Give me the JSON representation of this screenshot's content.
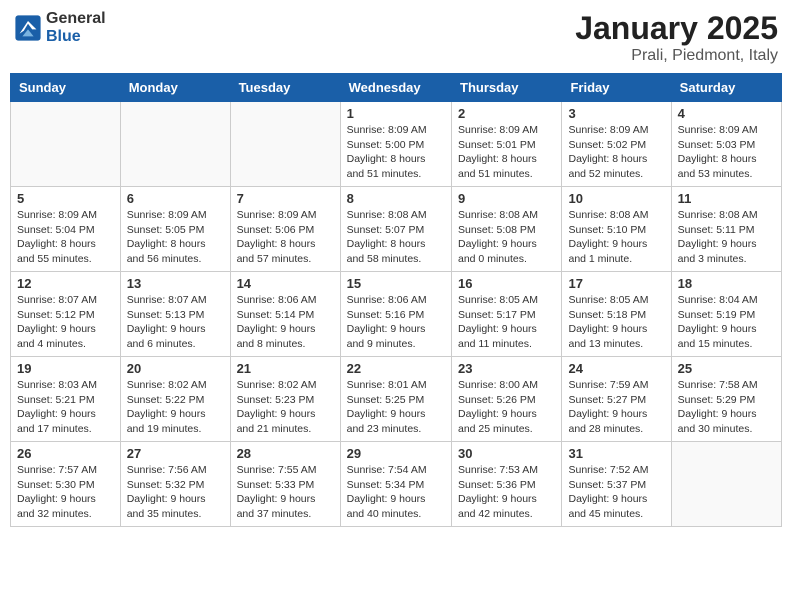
{
  "logo": {
    "general": "General",
    "blue": "Blue"
  },
  "header": {
    "month": "January 2025",
    "location": "Prali, Piedmont, Italy"
  },
  "weekdays": [
    "Sunday",
    "Monday",
    "Tuesday",
    "Wednesday",
    "Thursday",
    "Friday",
    "Saturday"
  ],
  "weeks": [
    [
      {
        "day": "",
        "info": ""
      },
      {
        "day": "",
        "info": ""
      },
      {
        "day": "",
        "info": ""
      },
      {
        "day": "1",
        "info": "Sunrise: 8:09 AM\nSunset: 5:00 PM\nDaylight: 8 hours\nand 51 minutes."
      },
      {
        "day": "2",
        "info": "Sunrise: 8:09 AM\nSunset: 5:01 PM\nDaylight: 8 hours\nand 51 minutes."
      },
      {
        "day": "3",
        "info": "Sunrise: 8:09 AM\nSunset: 5:02 PM\nDaylight: 8 hours\nand 52 minutes."
      },
      {
        "day": "4",
        "info": "Sunrise: 8:09 AM\nSunset: 5:03 PM\nDaylight: 8 hours\nand 53 minutes."
      }
    ],
    [
      {
        "day": "5",
        "info": "Sunrise: 8:09 AM\nSunset: 5:04 PM\nDaylight: 8 hours\nand 55 minutes."
      },
      {
        "day": "6",
        "info": "Sunrise: 8:09 AM\nSunset: 5:05 PM\nDaylight: 8 hours\nand 56 minutes."
      },
      {
        "day": "7",
        "info": "Sunrise: 8:09 AM\nSunset: 5:06 PM\nDaylight: 8 hours\nand 57 minutes."
      },
      {
        "day": "8",
        "info": "Sunrise: 8:08 AM\nSunset: 5:07 PM\nDaylight: 8 hours\nand 58 minutes."
      },
      {
        "day": "9",
        "info": "Sunrise: 8:08 AM\nSunset: 5:08 PM\nDaylight: 9 hours\nand 0 minutes."
      },
      {
        "day": "10",
        "info": "Sunrise: 8:08 AM\nSunset: 5:10 PM\nDaylight: 9 hours\nand 1 minute."
      },
      {
        "day": "11",
        "info": "Sunrise: 8:08 AM\nSunset: 5:11 PM\nDaylight: 9 hours\nand 3 minutes."
      }
    ],
    [
      {
        "day": "12",
        "info": "Sunrise: 8:07 AM\nSunset: 5:12 PM\nDaylight: 9 hours\nand 4 minutes."
      },
      {
        "day": "13",
        "info": "Sunrise: 8:07 AM\nSunset: 5:13 PM\nDaylight: 9 hours\nand 6 minutes."
      },
      {
        "day": "14",
        "info": "Sunrise: 8:06 AM\nSunset: 5:14 PM\nDaylight: 9 hours\nand 8 minutes."
      },
      {
        "day": "15",
        "info": "Sunrise: 8:06 AM\nSunset: 5:16 PM\nDaylight: 9 hours\nand 9 minutes."
      },
      {
        "day": "16",
        "info": "Sunrise: 8:05 AM\nSunset: 5:17 PM\nDaylight: 9 hours\nand 11 minutes."
      },
      {
        "day": "17",
        "info": "Sunrise: 8:05 AM\nSunset: 5:18 PM\nDaylight: 9 hours\nand 13 minutes."
      },
      {
        "day": "18",
        "info": "Sunrise: 8:04 AM\nSunset: 5:19 PM\nDaylight: 9 hours\nand 15 minutes."
      }
    ],
    [
      {
        "day": "19",
        "info": "Sunrise: 8:03 AM\nSunset: 5:21 PM\nDaylight: 9 hours\nand 17 minutes."
      },
      {
        "day": "20",
        "info": "Sunrise: 8:02 AM\nSunset: 5:22 PM\nDaylight: 9 hours\nand 19 minutes."
      },
      {
        "day": "21",
        "info": "Sunrise: 8:02 AM\nSunset: 5:23 PM\nDaylight: 9 hours\nand 21 minutes."
      },
      {
        "day": "22",
        "info": "Sunrise: 8:01 AM\nSunset: 5:25 PM\nDaylight: 9 hours\nand 23 minutes."
      },
      {
        "day": "23",
        "info": "Sunrise: 8:00 AM\nSunset: 5:26 PM\nDaylight: 9 hours\nand 25 minutes."
      },
      {
        "day": "24",
        "info": "Sunrise: 7:59 AM\nSunset: 5:27 PM\nDaylight: 9 hours\nand 28 minutes."
      },
      {
        "day": "25",
        "info": "Sunrise: 7:58 AM\nSunset: 5:29 PM\nDaylight: 9 hours\nand 30 minutes."
      }
    ],
    [
      {
        "day": "26",
        "info": "Sunrise: 7:57 AM\nSunset: 5:30 PM\nDaylight: 9 hours\nand 32 minutes."
      },
      {
        "day": "27",
        "info": "Sunrise: 7:56 AM\nSunset: 5:32 PM\nDaylight: 9 hours\nand 35 minutes."
      },
      {
        "day": "28",
        "info": "Sunrise: 7:55 AM\nSunset: 5:33 PM\nDaylight: 9 hours\nand 37 minutes."
      },
      {
        "day": "29",
        "info": "Sunrise: 7:54 AM\nSunset: 5:34 PM\nDaylight: 9 hours\nand 40 minutes."
      },
      {
        "day": "30",
        "info": "Sunrise: 7:53 AM\nSunset: 5:36 PM\nDaylight: 9 hours\nand 42 minutes."
      },
      {
        "day": "31",
        "info": "Sunrise: 7:52 AM\nSunset: 5:37 PM\nDaylight: 9 hours\nand 45 minutes."
      },
      {
        "day": "",
        "info": ""
      }
    ]
  ]
}
